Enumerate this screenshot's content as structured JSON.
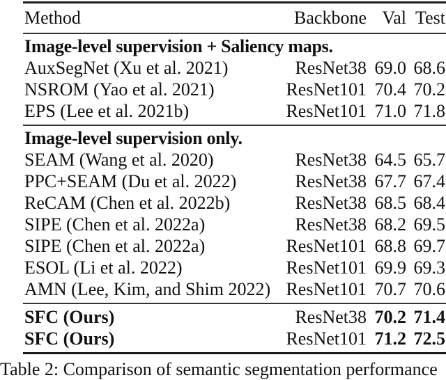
{
  "table": {
    "columns": {
      "method": "Method",
      "backbone": "Backbone",
      "val": "Val",
      "test": "Test"
    },
    "sections": [
      {
        "title": "Image-level supervision + Saliency maps.",
        "rows": [
          {
            "method": "AuxSegNet (Xu et al. 2021)",
            "backbone": "ResNet38",
            "val": "69.0",
            "test": "68.6"
          },
          {
            "method": "NSROM (Yao et al. 2021)",
            "backbone": "ResNet101",
            "val": "70.4",
            "test": "70.2"
          },
          {
            "method": "EPS (Lee et al. 2021b)",
            "backbone": "ResNet101",
            "val": "71.0",
            "test": "71.8"
          }
        ]
      },
      {
        "title": "Image-level supervision only.",
        "rows": [
          {
            "method": "SEAM (Wang et al. 2020)",
            "backbone": "ResNet38",
            "val": "64.5",
            "test": "65.7"
          },
          {
            "method": "PPC+SEAM (Du et al. 2022)",
            "backbone": "ResNet38",
            "val": "67.7",
            "test": "67.4"
          },
          {
            "method": "ReCAM (Chen et al. 2022b)",
            "backbone": "ResNet38",
            "val": "68.5",
            "test": "68.4"
          },
          {
            "method": "SIPE (Chen et al. 2022a)",
            "backbone": "ResNet38",
            "val": "68.2",
            "test": "69.5"
          },
          {
            "method": "SIPE (Chen et al. 2022a)",
            "backbone": "ResNet101",
            "val": "68.8",
            "test": "69.7"
          },
          {
            "method": "ESOL (Li et al. 2022)",
            "backbone": "ResNet101",
            "val": "69.9",
            "test": "69.3"
          },
          {
            "method": "AMN (Lee, Kim, and Shim 2022)",
            "backbone": "ResNet101",
            "val": "70.7",
            "test": "70.6"
          }
        ]
      },
      {
        "title": "",
        "rows": [
          {
            "method": "SFC (Ours)",
            "backbone": "ResNet38",
            "val": "70.2",
            "test": "71.4"
          },
          {
            "method": "SFC (Ours)",
            "backbone": "ResNet101",
            "val": "71.2",
            "test": "72.5"
          }
        ]
      }
    ]
  },
  "caption": "Table 2: Comparison of semantic segmentation performance"
}
